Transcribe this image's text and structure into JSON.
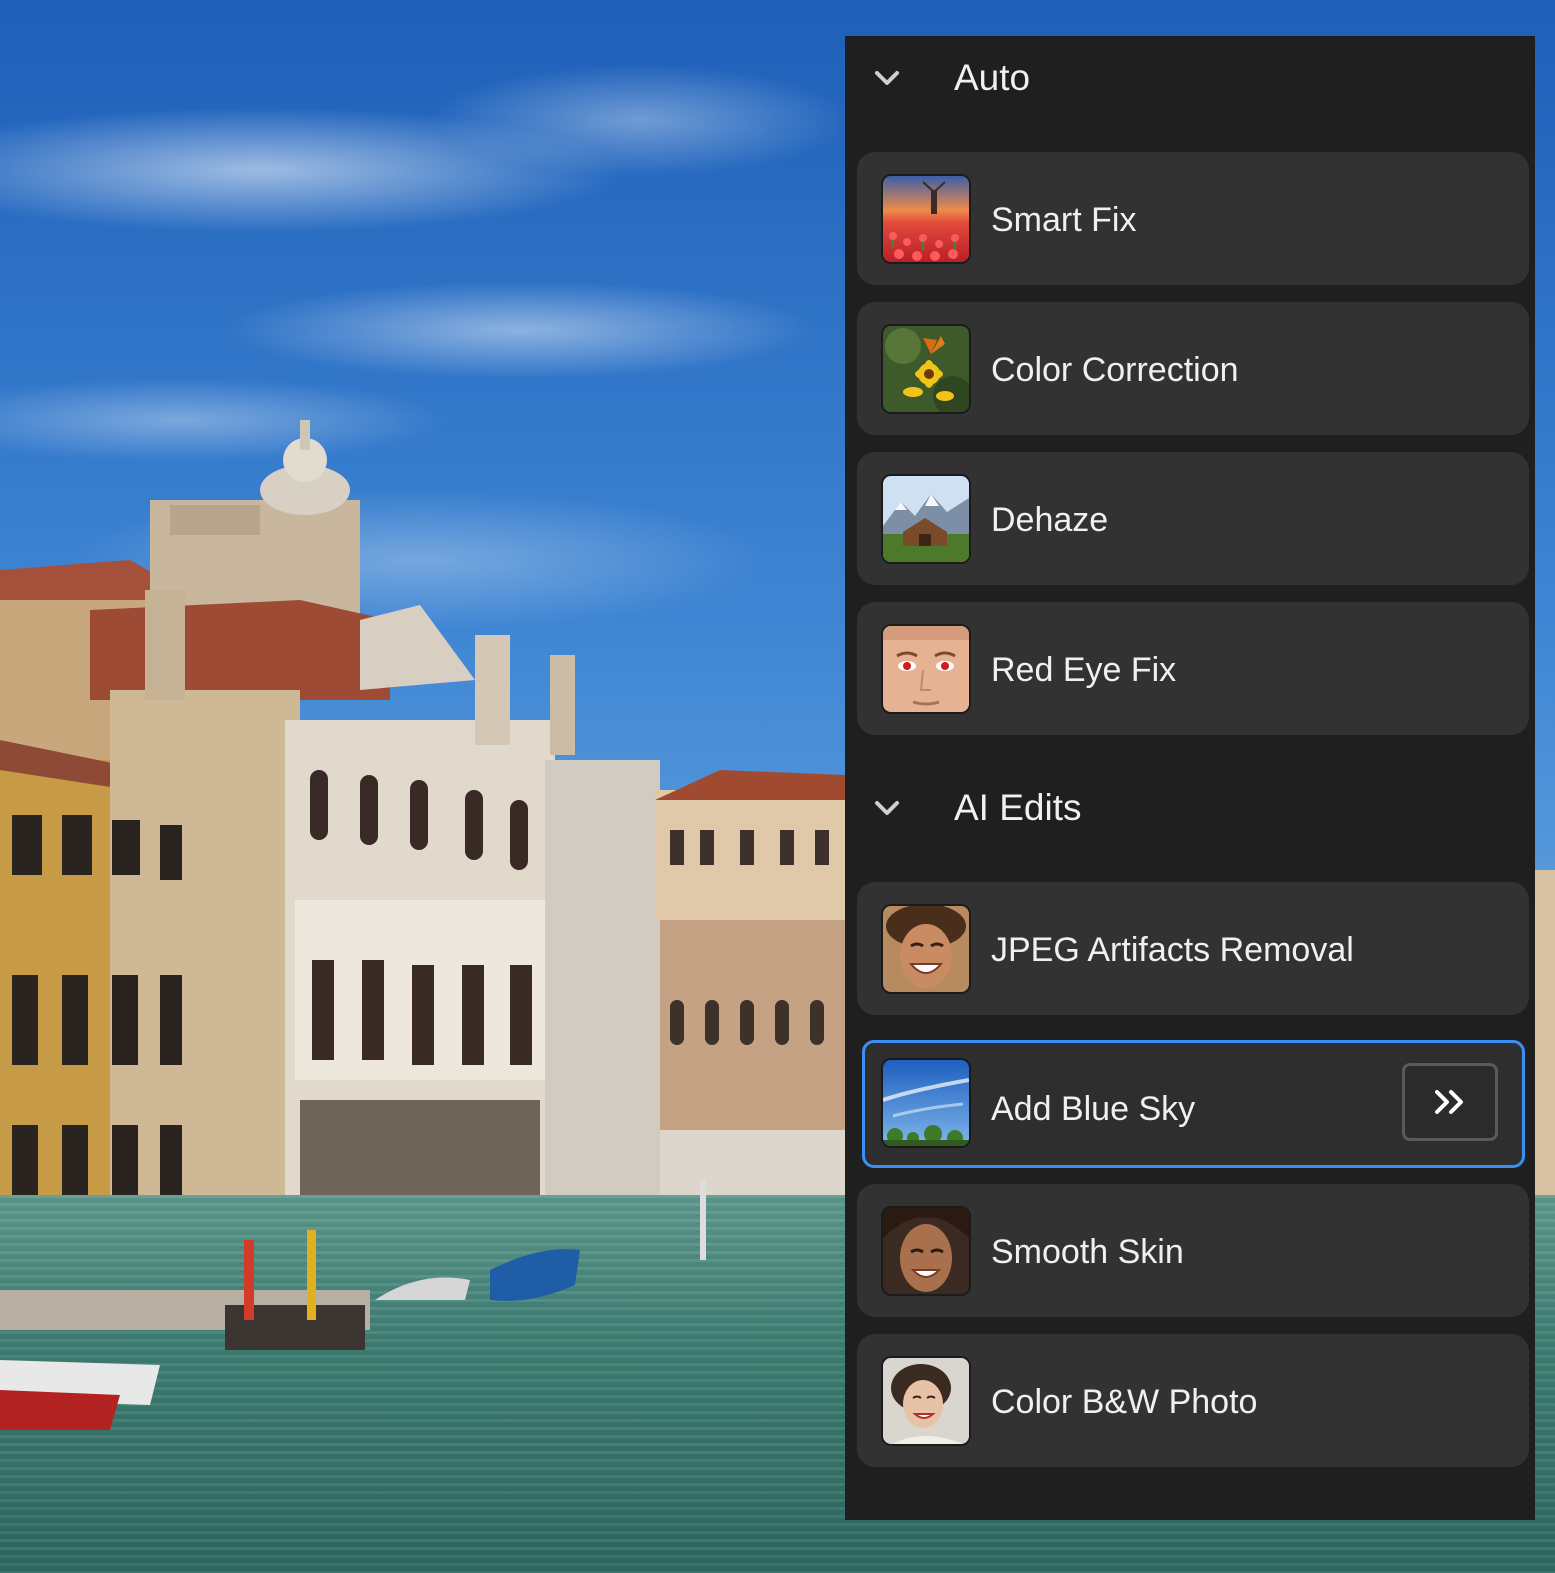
{
  "panel": {
    "sections": [
      {
        "title": "Auto",
        "items": [
          {
            "label": "Smart Fix",
            "thumbnail": "tulip-field-windmill"
          },
          {
            "label": "Color Correction",
            "thumbnail": "butterfly-on-sunflower"
          },
          {
            "label": "Dehaze",
            "thumbnail": "barn-mountains"
          },
          {
            "label": "Red Eye Fix",
            "thumbnail": "face-red-eyes"
          }
        ]
      },
      {
        "title": "AI Edits",
        "items": [
          {
            "label": "JPEG Artifacts Removal",
            "thumbnail": "smiling-woman"
          },
          {
            "label": "Add Blue Sky",
            "thumbnail": "blue-sky-trees",
            "selected": true,
            "action_icon": "double-chevron-right-icon"
          },
          {
            "label": "Smooth Skin",
            "thumbnail": "smiling-woman-portrait"
          },
          {
            "label": "Color B&W Photo",
            "thumbnail": "vintage-woman-portrait"
          }
        ]
      }
    ]
  },
  "colors": {
    "panel_bg": "#1f1f1f",
    "card_bg": "#323232",
    "selection_accent": "#3b8ff3",
    "text": "#f0f0f0"
  },
  "background_image": "venice-grand-canal-buildings-blue-sky"
}
